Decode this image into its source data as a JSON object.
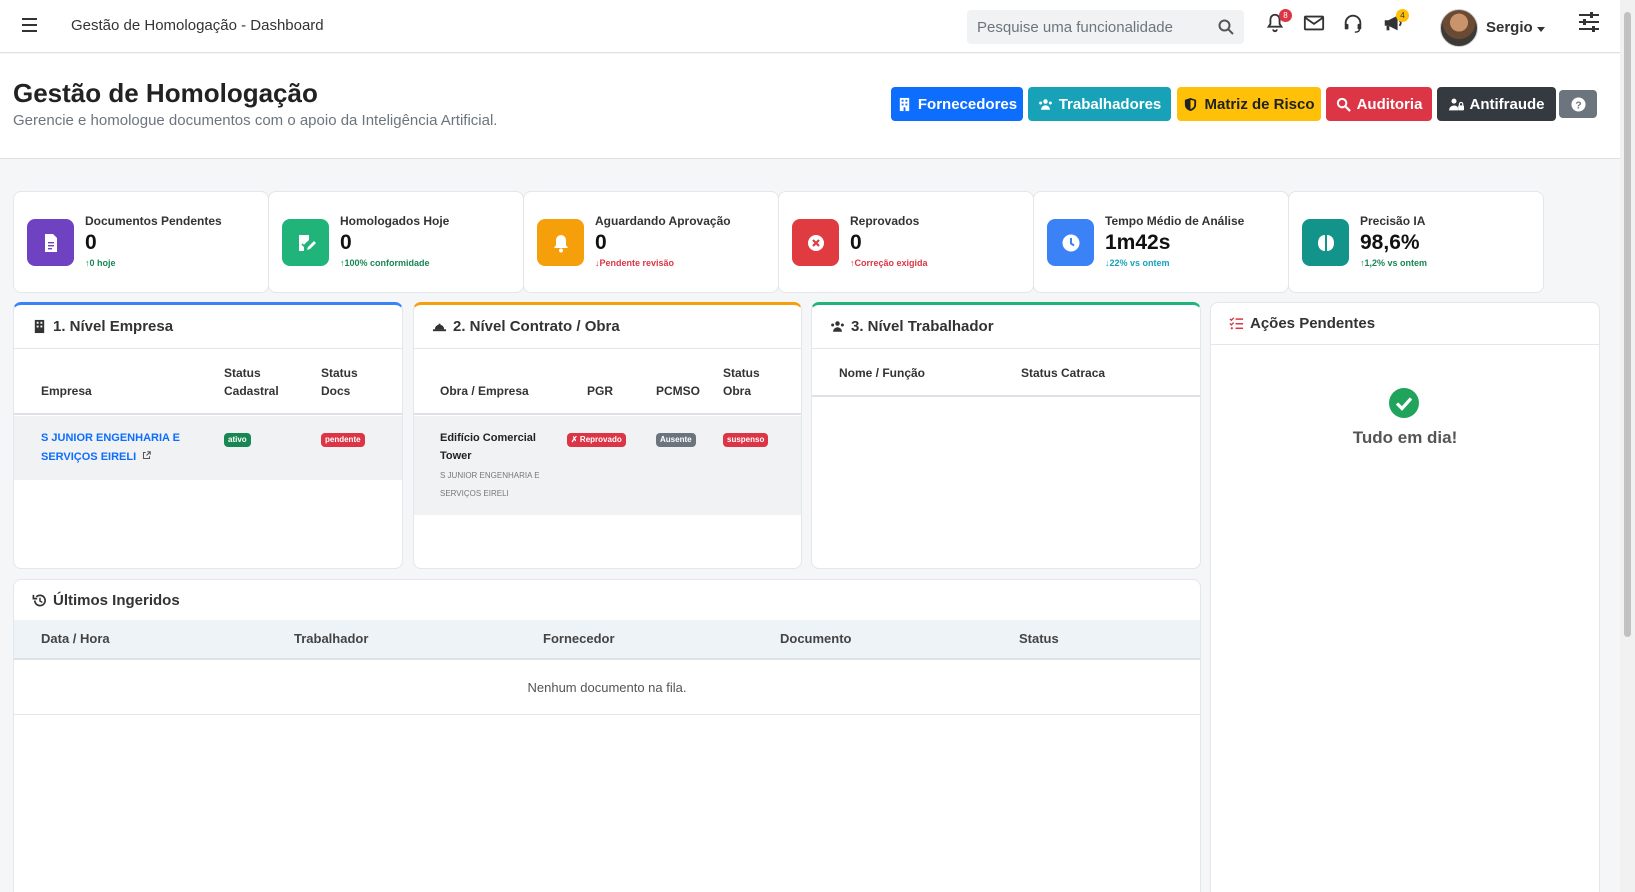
{
  "nav": {
    "title": "Gestão de Homologação - Dashboard",
    "search_placeholder": "Pesquise uma funcionalidade",
    "notifications_badge": "8",
    "announcements_badge": "4",
    "user_name": "Sergio"
  },
  "header": {
    "title": "Gestão de Homologação",
    "subtitle": "Gerencie e homologue documentos com o apoio da Inteligência Artificial.",
    "buttons": [
      {
        "label": "Fornecedores",
        "color": "#0d6efd"
      },
      {
        "label": "Trabalhadores",
        "color": "#17a2b8"
      },
      {
        "label": "Matriz de Risco",
        "color": "#ffc107"
      },
      {
        "label": "Auditoria",
        "color": "#dc3545"
      },
      {
        "label": "Antifraude",
        "color": "#343a40"
      }
    ],
    "help_color": "#6c757d"
  },
  "stats": [
    {
      "label": "Documentos Pendentes",
      "value": "0",
      "trend": "0 hoje",
      "trend_dir": "up",
      "trend_color": "#198754",
      "icon": "document-icon",
      "color": "#6f42c1"
    },
    {
      "label": "Homologados Hoje",
      "value": "0",
      "trend": "100% conformidade",
      "trend_dir": "up",
      "trend_color": "#198754",
      "icon": "edit-check-icon",
      "color": "#20b37a"
    },
    {
      "label": "Aguardando Aprovação",
      "value": "0",
      "trend": "Pendente revisão",
      "trend_dir": "down",
      "trend_color": "#dc3545",
      "icon": "bell-icon",
      "color": "#f59f0b"
    },
    {
      "label": "Reprovados",
      "value": "0",
      "trend": "Correção exigida",
      "trend_dir": "up",
      "trend_color": "#dc3545",
      "icon": "x-circle-icon",
      "color": "#e03b41"
    },
    {
      "label": "Tempo Médio de Análise",
      "value": "1m42s",
      "trend": "22% vs ontem",
      "trend_dir": "down",
      "trend_color": "#17a2b8",
      "icon": "clock-icon",
      "color": "#3b82f6"
    },
    {
      "label": "Precisão IA",
      "value": "98,6%",
      "trend": "1,2% vs ontem",
      "trend_dir": "up",
      "trend_color": "#198754",
      "icon": "brain-icon",
      "color": "#12948a"
    }
  ],
  "empresa": {
    "title": "1. Nível Empresa",
    "accent": "#3b82f6",
    "headers": [
      "Empresa",
      "Status",
      "Cadastral",
      "Status",
      "Docs"
    ],
    "row": {
      "company": "S JUNIOR ENGENHARIA E SERVIÇOS EIRELI",
      "status_cadastral": "ativo",
      "status_docs": "pendente"
    }
  },
  "contrato": {
    "title": "2. Nível Contrato / Obra",
    "accent": "#f59f0b",
    "headers": [
      "Obra / Empresa",
      "PGR",
      "PCMSO",
      "Status",
      "Obra"
    ],
    "row": {
      "obra": "Edifício Comercial Tower",
      "empresa": "S JUNIOR ENGENHARIA E SERVIÇOS EIRELI",
      "pgr": "✗ Reprovado",
      "pcmso": "Ausente",
      "status_obra": "suspenso"
    }
  },
  "trabalhador": {
    "title": "3. Nível Trabalhador",
    "accent": "#20b37a",
    "headers": [
      "Nome / Função",
      "Status Catraca"
    ]
  },
  "acoes": {
    "title": "Ações Pendentes",
    "empty_text": "Tudo em dia!"
  },
  "ingeridos": {
    "title": "Últimos Ingeridos",
    "headers": [
      "Data / Hora",
      "Trabalhador",
      "Fornecedor",
      "Documento",
      "Status"
    ],
    "empty_text": "Nenhum documento na fila."
  }
}
